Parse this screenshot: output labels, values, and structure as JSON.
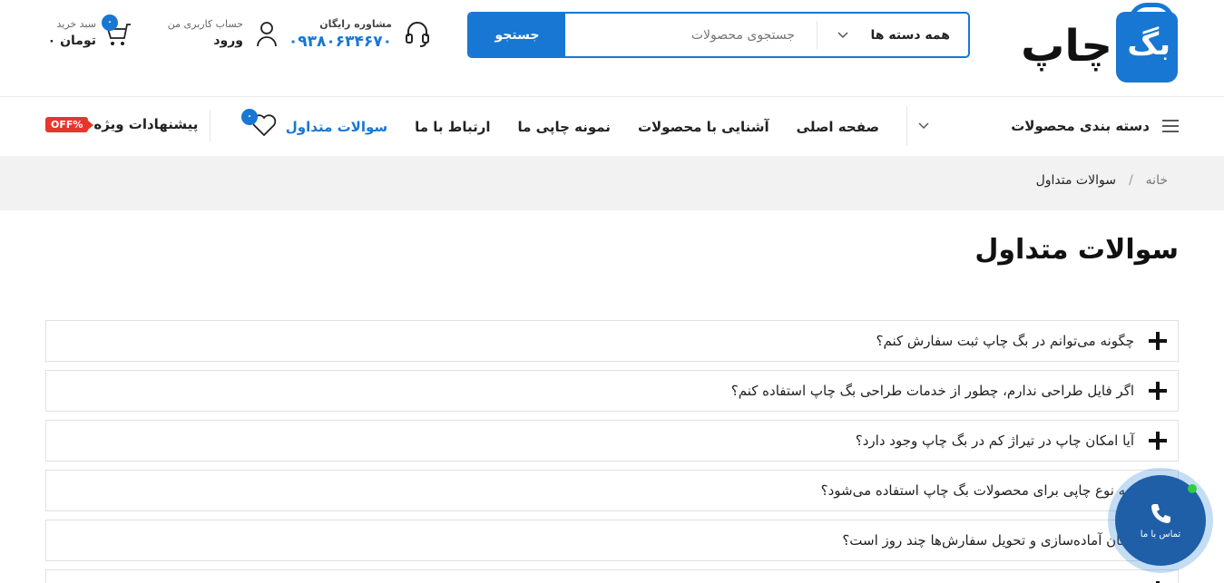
{
  "header": {
    "logo": {
      "bag_text": "بگ",
      "chap_text": "چاپ"
    },
    "search": {
      "category_label": "همه دسته ها",
      "placeholder": "جستجوی محصولات",
      "button_label": "جستجو"
    },
    "consult": {
      "label": "مشاوره رایگان",
      "phone": "۰۹۳۸۰۶۳۴۶۷۰"
    },
    "account": {
      "label": "حساب کاربری من",
      "value": "ورود"
    },
    "cart": {
      "label": "سبد خرید",
      "value": "۰ تومان",
      "count": "۰"
    }
  },
  "nav": {
    "category_menu_label": "دسته بندی محصولات",
    "links": [
      {
        "label": "صفحه اصلی"
      },
      {
        "label": "آشنایی با محصولات"
      },
      {
        "label": "نمونه چاپی ما"
      },
      {
        "label": "ارتباط با ما"
      },
      {
        "label": "سوالات متداول"
      }
    ],
    "wishlist_count": "۰",
    "special_label": "پیشنهادات ویژه",
    "off_tag": "OFF%"
  },
  "breadcrumb": {
    "home": "خانه",
    "separator": "/",
    "current": "سوالات متداول"
  },
  "page_title": "سوالات متداول",
  "faq": [
    "چگونه می‌توانم در بگ چاپ ثبت سفارش کنم؟",
    "اگر فایل طراحی ندارم، چطور از خدمات طراحی بگ چاپ استفاده کنم؟",
    "آیا امکان چاپ در تیراژ کم در بگ چاپ وجود دارد؟",
    "چه نوع چاپی برای محصولات بگ چاپ استفاده می‌شود؟",
    "زمان آماده‌سازی و تحویل سفارش‌ها چند روز است؟"
  ],
  "call_widget": {
    "label": "تماس با ما"
  },
  "colors": {
    "accent": "#1877d2",
    "off": "#e8362c"
  }
}
